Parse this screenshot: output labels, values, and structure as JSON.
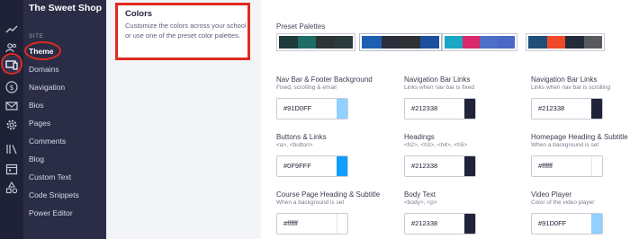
{
  "app": {
    "title": "The Sweet Shop"
  },
  "rail": {
    "icons": [
      "trend-chart-icon",
      "users-icon",
      "theme-device-icon",
      "dollar-icon",
      "mail-icon",
      "gear-icon",
      "library-icon",
      "calendar-icon",
      "shapes-icon"
    ]
  },
  "sidebar": {
    "section": "SITE",
    "items": [
      {
        "label": "Theme",
        "active": true
      },
      {
        "label": "Domains"
      },
      {
        "label": "Navigation"
      },
      {
        "label": "Bios"
      },
      {
        "label": "Pages"
      },
      {
        "label": "Comments"
      },
      {
        "label": "Blog"
      },
      {
        "label": "Custom Text"
      },
      {
        "label": "Code Snippets"
      },
      {
        "label": "Power Editor"
      }
    ]
  },
  "panel": {
    "title": "Colors",
    "description": "Customize the colors across your school or use one of the preset color palettes."
  },
  "main": {
    "presets_label": "Preset Palettes",
    "palettes": [
      {
        "colors": [
          "#1d3b3b",
          "#1f6b66",
          "#2d3434",
          "#2b3a3a"
        ]
      },
      {
        "colors": [
          "#1d5fb3",
          "#2b2d3a",
          "#2e3033",
          "#1c4f9c"
        ]
      },
      {
        "colors": [
          "#1aa7c6",
          "#d9286b",
          "#4f6ec8",
          "#4a68c4"
        ]
      },
      {
        "colors": [
          "#1f4f78",
          "#f0492a",
          "#232a3a",
          "#58595e"
        ]
      }
    ],
    "fields": [
      {
        "label": "Nav Bar & Footer Background",
        "sub": "Fixed, scrolling & email",
        "value": "#91D0FF",
        "swatch": "#91D0FF"
      },
      {
        "label": "Navigation Bar Links",
        "sub": "Links when nav bar is fixed",
        "value": "#212338",
        "swatch": "#212338"
      },
      {
        "label": "Navigation Bar Links",
        "sub": "Links when nav bar is scrolling",
        "value": "#212338",
        "swatch": "#212338"
      },
      {
        "label": "Buttons & Links",
        "sub": "<a>, <button>",
        "value": "#0F9FFF",
        "swatch": "#0F9FFF"
      },
      {
        "label": "Headings",
        "sub": "<h2>, <h3>, <h4>, <h5>",
        "value": "#212338",
        "swatch": "#212338"
      },
      {
        "label": "Homepage Heading & Subtitle",
        "sub": "When a background is set",
        "value": "#ffffff",
        "swatch": "#ffffff"
      },
      {
        "label": "Course Page Heading & Subtitle",
        "sub": "When a background is set",
        "value": "#ffffff",
        "swatch": "#ffffff"
      },
      {
        "label": "Body Text",
        "sub": "<body>, <p>",
        "value": "#212338",
        "swatch": "#212338"
      },
      {
        "label": "Video Player",
        "sub": "Color of the video player",
        "value": "#91D0FF",
        "swatch": "#91D0FF"
      }
    ]
  }
}
